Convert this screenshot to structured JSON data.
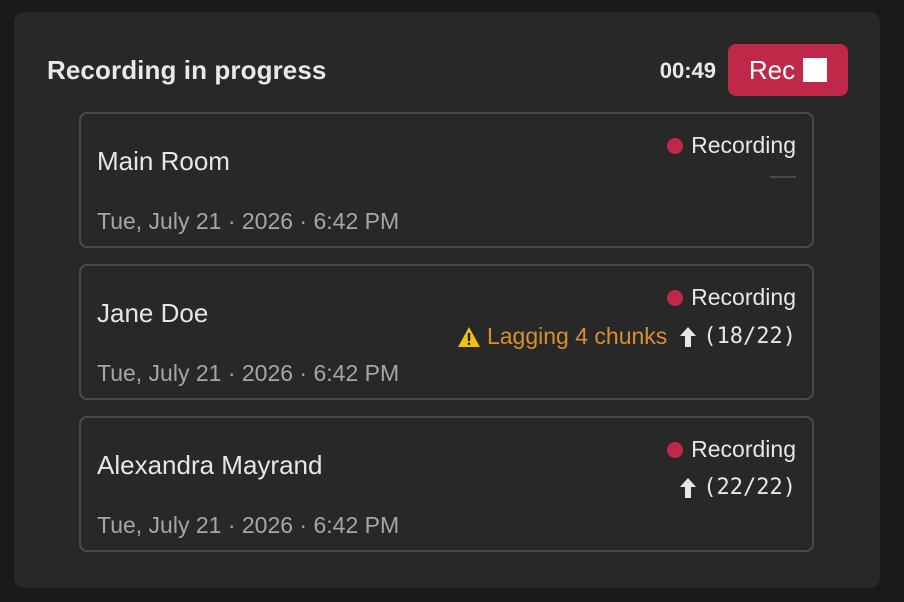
{
  "header": {
    "title": "Recording in progress",
    "timer": "00:49",
    "rec_button_label": "Rec"
  },
  "colors": {
    "accent": "#c0284a",
    "warning": "#d8902e",
    "panel": "#282828",
    "background": "#1a1a1a"
  },
  "participants": [
    {
      "name": "Main Room",
      "date": "Tue, July 21 · 2026 · 6:42 PM",
      "status": "Recording",
      "lag_text": "",
      "upload": ""
    },
    {
      "name": "Jane Doe",
      "date": "Tue, July 21 · 2026 · 6:42 PM",
      "status": "Recording",
      "lag_text": "Lagging 4 chunks",
      "upload": "(18/22)"
    },
    {
      "name": "Alexandra Mayrand",
      "date": "Tue, July 21 · 2026 · 6:42 PM",
      "status": "Recording",
      "lag_text": "",
      "upload": "(22/22)"
    }
  ]
}
